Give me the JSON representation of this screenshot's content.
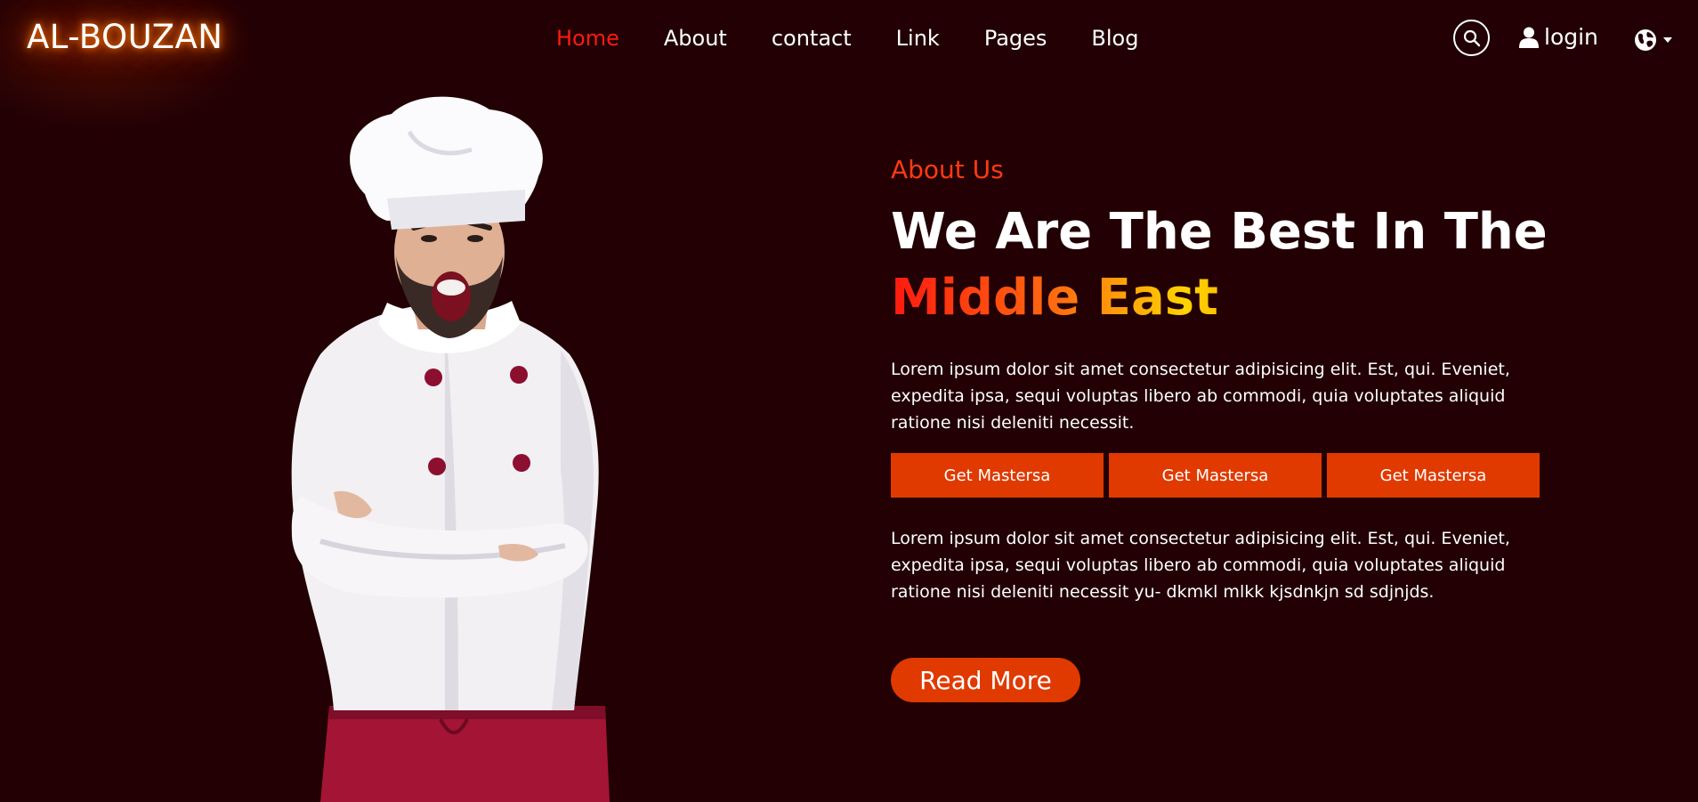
{
  "brand": {
    "name": "AL-BOUZAN"
  },
  "nav": {
    "items": [
      {
        "label": "Home",
        "active": true
      },
      {
        "label": "About"
      },
      {
        "label": "contact"
      },
      {
        "label": "Link"
      },
      {
        "label": "Pages"
      },
      {
        "label": "Blog"
      }
    ]
  },
  "header": {
    "search_icon": "search-icon",
    "login_icon": "user-icon",
    "login_label": "login",
    "language_icon": "globe-icon",
    "language_caret": "caret-down-icon"
  },
  "hero": {
    "eyebrow": "About Us",
    "headline_line1": "We Are The Best In The",
    "headline_line2": "Middle East",
    "paragraph_1": "Lorem ipsum dolor sit amet consectetur adipisicing elit. Est, qui. Eveniet, expedita ipsa, sequi voluptas libero ab commodi, quia voluptates aliquid ratione nisi deleniti necessit.",
    "buttons": [
      {
        "label": "Get Mastersa"
      },
      {
        "label": "Get Mastersa"
      },
      {
        "label": "Get Mastersa"
      }
    ],
    "paragraph_2": "Lorem ipsum dolor sit amet consectetur adipisicing elit. Est, qui. Eveniet, expedita ipsa, sequi voluptas libero ab commodi, quia voluptates aliquid ratione nisi deleniti necessit yu- dkmkl mlkk kjsdnkjn sd sdjnjds.",
    "read_more": "Read More"
  },
  "colors": {
    "background": "#220004",
    "accent": "#e03a00",
    "nav_active": "#ff1a10",
    "eyebrow": "#ff3a12"
  }
}
